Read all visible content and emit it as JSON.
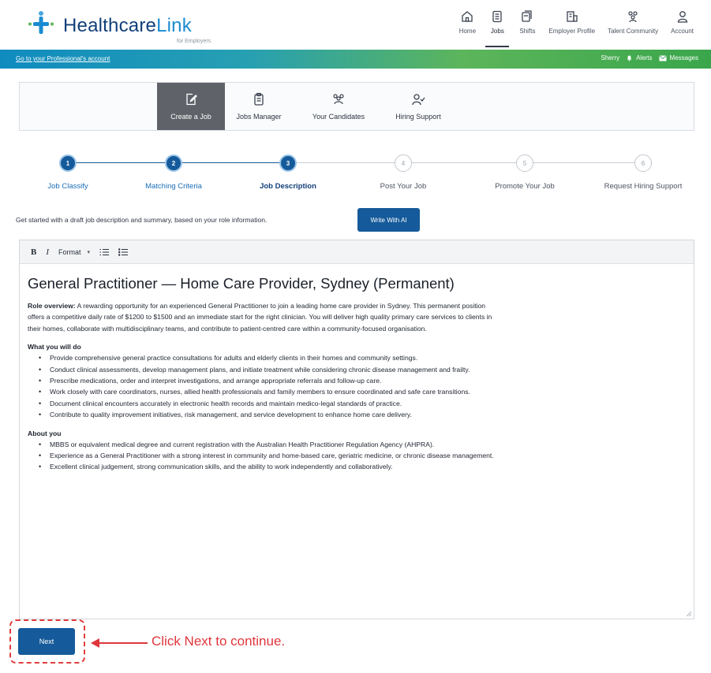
{
  "brand": {
    "name_part1": "Healthcare",
    "name_part2": "Link",
    "subtitle": "for Employers"
  },
  "topnav": [
    {
      "label": "Home",
      "icon": "home-icon"
    },
    {
      "label": "Jobs",
      "icon": "jobs-icon",
      "active": true
    },
    {
      "label": "Shifts",
      "icon": "shifts-icon"
    },
    {
      "label": "Employer Profile",
      "icon": "building-icon"
    },
    {
      "label": "Talent Community",
      "icon": "community-icon"
    },
    {
      "label": "Account",
      "icon": "user-icon"
    }
  ],
  "bar": {
    "professional_link": "Go to your Professional's account",
    "user": "Sherry",
    "alerts": "Alerts",
    "messages": "Messages"
  },
  "subnav": [
    {
      "label": "Create a Job",
      "icon": "create-job-icon",
      "active": true
    },
    {
      "label": "Jobs Manager",
      "icon": "clipboard-icon"
    },
    {
      "label": "Your Candidates",
      "icon": "candidates-icon"
    },
    {
      "label": "Hiring Support",
      "icon": "hiring-support-icon"
    }
  ],
  "steps": [
    {
      "number": "1",
      "label": "Job Classify",
      "state": "done"
    },
    {
      "number": "2",
      "label": "Matching Criteria",
      "state": "done"
    },
    {
      "number": "3",
      "label": "Job Description",
      "state": "current"
    },
    {
      "number": "4",
      "label": "Post Your Job",
      "state": "todo"
    },
    {
      "number": "5",
      "label": "Promote Your Job",
      "state": "todo"
    },
    {
      "number": "6",
      "label": "Request Hiring Support",
      "state": "todo"
    }
  ],
  "ai": {
    "prompt": "Get started with a draft job description and summary, based on your role information.",
    "button": "Write With AI"
  },
  "toolbar": {
    "bold": "B",
    "italic": "I",
    "format": "Format"
  },
  "document": {
    "title": "General Practitioner — Home Care Provider, Sydney (Permanent)",
    "overview_label": "Role overview:",
    "overview_text": " A rewarding opportunity for an experienced General Practitioner to join a leading home care provider in Sydney. This permanent position offers a competitive daily rate of $1200 to $1500 and an immediate start for the right clinician. You will deliver high quality primary care services to clients in their homes, collaborate with multidisciplinary teams, and contribute to patient-centred care within a community-focused organisation.",
    "what_heading": "What you will do",
    "what_items": [
      "Provide comprehensive general practice consultations for adults and elderly clients in their homes and community settings.",
      "Conduct clinical assessments, develop management plans, and initiate treatment while considering chronic disease management and frailty.",
      "Prescribe medications, order and interpret investigations, and arrange appropriate referrals and follow-up care.",
      "Work closely with care coordinators, nurses, allied health professionals and family members to ensure coordinated and safe care transitions.",
      "Document clinical encounters accurately in electronic health records and maintain medico-legal standards of practice.",
      "Contribute to quality improvement initiatives, risk management, and service development to enhance home care delivery."
    ],
    "about_heading": "About you",
    "about_items": [
      "MBBS or equivalent medical degree and current registration with the Australian Health Practitioner Regulation Agency (AHPRA).",
      "Experience as a General Practitioner with a strong interest in community and home-based care, geriatric medicine, or chronic disease management.",
      "Excellent clinical judgement, strong communication skills, and the ability to work independently and collaboratively."
    ]
  },
  "next_button": "Next",
  "callout": "Click Next to continue.",
  "colors": {
    "primary": "#155a9a",
    "annotation": "#e0363c",
    "brand_dark": "#123f7a",
    "brand_light": "#1b8bd1"
  }
}
